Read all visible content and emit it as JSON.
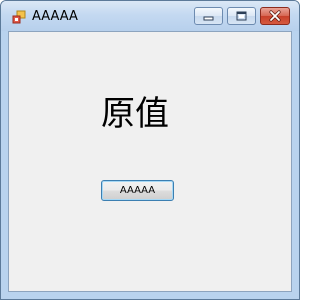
{
  "window": {
    "title": "AAAAA"
  },
  "title_buttons": {
    "minimize_icon": "minimize-icon",
    "maximize_icon": "maximize-icon",
    "close_icon": "close-icon"
  },
  "main": {
    "label_text": "原值",
    "button_label": "AAAAA"
  },
  "colors": {
    "client_background": "#f0f0f0",
    "close_button": "#c7402a",
    "button_focus_border": "#3c7fb1"
  }
}
